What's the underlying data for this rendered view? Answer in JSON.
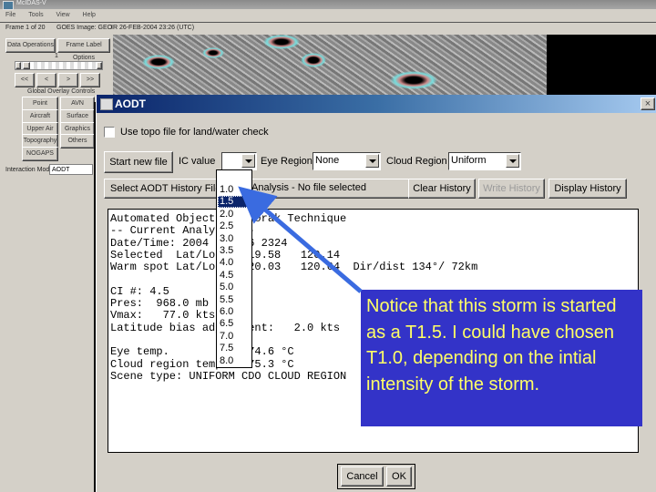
{
  "app": {
    "title": "McIDAS-V",
    "menu": [
      "File",
      "Tools",
      "View",
      "Help"
    ],
    "status": {
      "frame": "Frame 1 of 20",
      "image": "GOES Image: GEO",
      "datetime": "IR 26-FEB-2004 23:26 (UTC)"
    }
  },
  "left_panel": {
    "top_buttons": [
      "Data Operations",
      "Frame Label Options"
    ],
    "frame_number": "1",
    "nav_buttons": [
      "<<",
      "<",
      ">",
      ">>"
    ],
    "overlay_title": "Global Overlay Controls",
    "overlay_buttons": [
      "Point",
      "AVN",
      "Aircraft",
      "Surface",
      "Upper Air",
      "Graphics",
      "Topography",
      "Others",
      "NOGAPS"
    ],
    "interaction_label": "Interaction Mode",
    "interaction_value": "AODT"
  },
  "aodt": {
    "title": "AODT",
    "close": "×",
    "topo_checkbox_label": "Use topo file for land/water check",
    "topo_checked": false,
    "start_button": "Start new file",
    "ic_label": "IC value",
    "ic_value": "",
    "eye_label": "Eye Region",
    "eye_value": "None",
    "cloud_label": "Cloud Region",
    "cloud_value": "Uniform",
    "history_button": "Select AODT History File",
    "history_status": "Analysis - No file selected",
    "clear_history": "Clear History",
    "write_history": "Write History",
    "display_history": "Display History",
    "output_lines": [
      "Automated Objective Dvorak Technique",
      "-- Current Analysis --",
      "Date/Time: 2004 FEB 26 2324",
      "Selected  Lat/Lon : -19.58   120.14",
      "Warm spot Lat/Lon : -20.03   120.64  Dir/dist 134°/ 72km",
      "",
      "CI #: 4.5",
      "Pres:  968.0 mb",
      "Vmax:   77.0 kts",
      "Latitude bias adjustment:   2.0 kts",
      "",
      "Eye temp.         : -74.6 °C",
      "Cloud region temp : -75.3 °C",
      "Scene type: UNIFORM CDO CLOUD REGION"
    ],
    "cancel": "Cancel",
    "ok": "OK",
    "ic_options": [
      "1.0",
      "1.5",
      "2.0",
      "2.5",
      "3.0",
      "3.5",
      "4.0",
      "4.5",
      "5.0",
      "5.5",
      "6.0",
      "6.5",
      "7.0",
      "7.5",
      "8.0"
    ],
    "ic_highlighted": "1.5"
  },
  "annotation": {
    "text": "Notice that this storm is started as a T1.5. I could have chosen T1.0, depending on the intial intensity of the storm.",
    "bg_color": "#3333c8",
    "text_color": "#ffff66",
    "arrow_color": "#3a6be0"
  }
}
